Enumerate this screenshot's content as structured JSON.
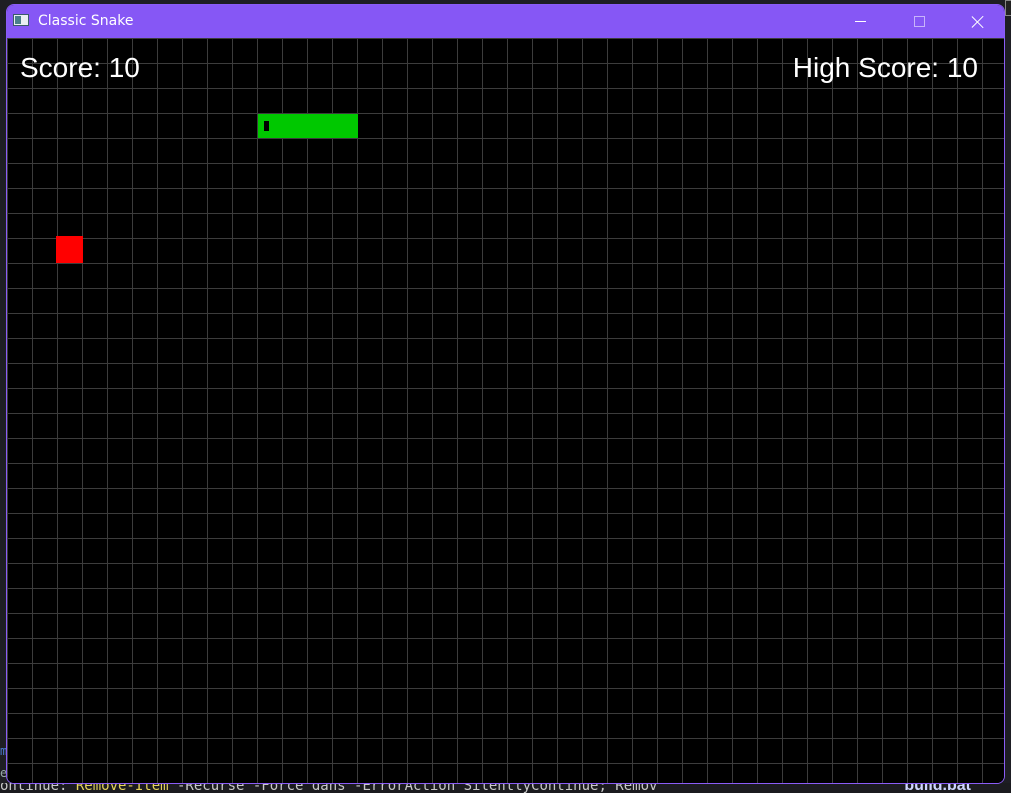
{
  "window": {
    "title": "Classic Snake",
    "accent_color": "#8657f5"
  },
  "window_controls": {
    "minimize_icon": "minimize-icon",
    "maximize_icon": "maximize-icon",
    "close_icon": "close-icon"
  },
  "hud": {
    "score_text": "Score: 10",
    "high_score_text": "High Score: 10"
  },
  "game": {
    "grid_columns": 40,
    "grid_rows": 30,
    "background_color": "#000000",
    "grid_line_color": "#3c3c3c",
    "snake_color": "#00c800",
    "food_color": "#ff0000",
    "snake": [
      {
        "col": 10,
        "row": 3
      },
      {
        "col": 11,
        "row": 3
      },
      {
        "col": 12,
        "row": 3
      },
      {
        "col": 13,
        "row": 3
      }
    ],
    "snake_direction": "left",
    "food": {
      "col": 2,
      "row": 8
    }
  },
  "background": {
    "terminal_line_parts": [
      {
        "text": "ontinue: ",
        "kind": "plain"
      },
      {
        "text": "Remove-Item",
        "kind": "kw"
      },
      {
        "text": " -Recurse -Force dans -ErrorAction SilentlyContinue; Remov",
        "kind": "plain"
      }
    ],
    "file_label": "build.bat"
  }
}
